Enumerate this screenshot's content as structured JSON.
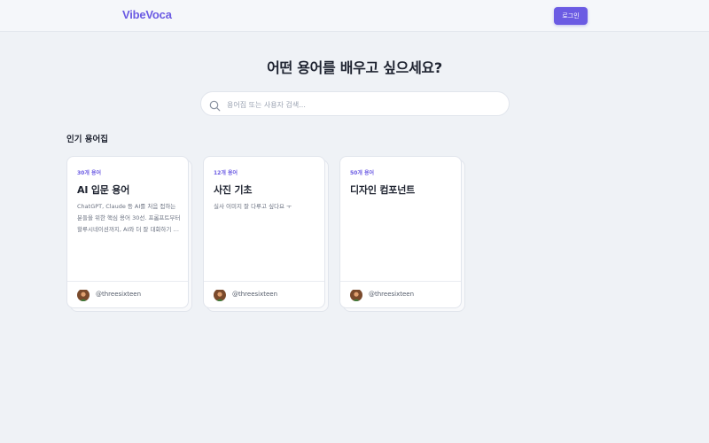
{
  "header": {
    "logo": "VibeVoca",
    "login_label": "로그인"
  },
  "hero": {
    "title": "어떤 용어를 배우고 싶으세요?"
  },
  "search": {
    "placeholder": "용어집 또는 사용자 검색..."
  },
  "popular": {
    "section_title": "인기 용어집",
    "cards": [
      {
        "count": "30개 용어",
        "title": "AI 입문 용어",
        "description": "ChatGPT, Claude 등 AI를 처음 접하는 분들을 위한 핵심 용어 30선. 프롬프트부터 할루시네이션까지, AI와 더 잘 대화하기 위한 기초 지식을 담았습니다.",
        "author": "@threesixteen"
      },
      {
        "count": "12개 용어",
        "title": "사진 기초",
        "description": "실사 이미지 잘 다루고 싶다요 ㅜ",
        "author": "@threesixteen"
      },
      {
        "count": "50개 용어",
        "title": "디자인 컴포넌트",
        "description": "",
        "author": "@threesixteen"
      }
    ]
  }
}
